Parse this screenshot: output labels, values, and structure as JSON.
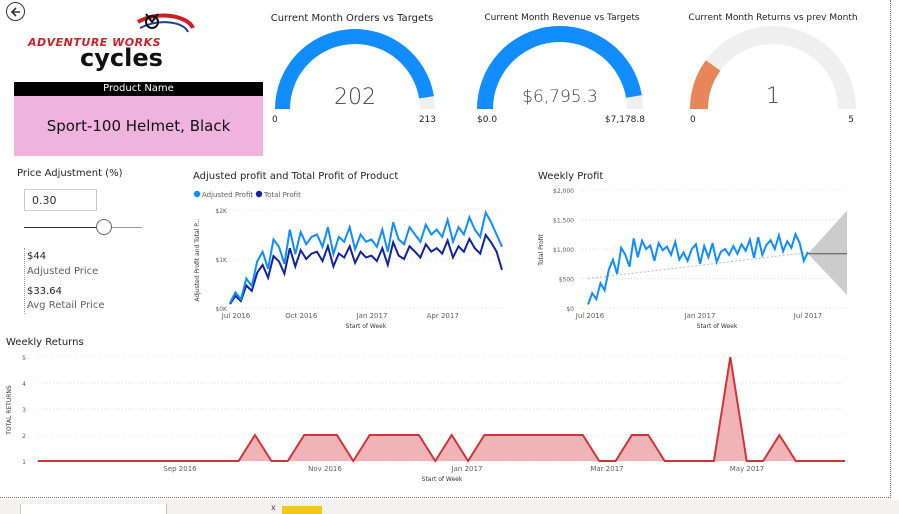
{
  "header": {
    "back_icon": "back-arrow-icon",
    "logo": {
      "line1": "ADVENTURE WORKS",
      "line2": "cycles",
      "colors": {
        "red": "#cc1f26",
        "dark": "#111111",
        "accent_blue": "#1b3fa8"
      }
    }
  },
  "slicer": {
    "header": "Product Name",
    "selected": "Sport-100 Helmet, Black"
  },
  "price_adjustment": {
    "title": "Price Adjustment (%)",
    "value": "0.30",
    "slider_fraction": 0.68,
    "adjusted_price": "$44",
    "adjusted_price_label": "Adjusted Price",
    "avg_retail_price": "$33.64",
    "avg_retail_price_label": "Avg Retail Price"
  },
  "gauges": [
    {
      "title": "Current Month Orders vs Targets",
      "value": 202,
      "display": "202",
      "min": 0,
      "max": 213,
      "min_label": "0",
      "max_label": "213",
      "color": "#118dff"
    },
    {
      "title": "Current Month Revenue vs Targets",
      "value": 6795.3,
      "display": "$6,795.3",
      "min": 0,
      "max": 7178.8,
      "min_label": "$0.0",
      "max_label": "$7,178.8",
      "color": "#118dff"
    },
    {
      "title": "Current Month Returns vs prev Month",
      "value": 1,
      "display": "1",
      "min": 0,
      "max": 5,
      "min_label": "0",
      "max_label": "5",
      "color": "#e8865a"
    }
  ],
  "chart_data": [
    {
      "type": "line",
      "title": "Adjusted profit and Total Profit of Product",
      "xlabel": "Start of Week",
      "ylabel": "Adjusted Profit and Total P...",
      "legend": "top-left",
      "x_ticks": [
        "Jul 2016",
        "Oct 2016",
        "Jan 2017",
        "Apr 2017"
      ],
      "x_tick_index": [
        0,
        12,
        25,
        38
      ],
      "y_ticks": [
        "$0K",
        "$1K",
        "$2K"
      ],
      "ylim": [
        0,
        2000
      ],
      "series": [
        {
          "name": "Adjusted Profit",
          "color": "#118dff",
          "values": [
            100,
            320,
            180,
            600,
            450,
            950,
            1150,
            800,
            1400,
            1250,
            900,
            1600,
            1100,
            1550,
            1300,
            1450,
            1500,
            1250,
            1650,
            1100,
            1450,
            1350,
            1650,
            1200,
            1500,
            1350,
            1400,
            1250,
            1600,
            1150,
            1750,
            1400,
            1300,
            1650,
            1500,
            1350,
            1700,
            1500,
            1600,
            1450,
            1800,
            1350,
            1650,
            1500,
            1850,
            1600,
            1450,
            1950,
            1750,
            1500,
            1250
          ]
        },
        {
          "name": "Total Profit",
          "color": "#12239e",
          "values": [
            80,
            250,
            140,
            460,
            350,
            720,
            880,
            620,
            1060,
            950,
            700,
            1220,
            850,
            1180,
            1000,
            1110,
            1150,
            960,
            1260,
            850,
            1110,
            1030,
            1260,
            920,
            1150,
            1030,
            1070,
            960,
            1220,
            880,
            1340,
            1070,
            1000,
            1260,
            1150,
            1030,
            1300,
            1150,
            1220,
            1110,
            1380,
            1030,
            1260,
            1150,
            1410,
            1220,
            1110,
            1490,
            1340,
            1150,
            780
          ]
        }
      ]
    },
    {
      "type": "line",
      "title": "Weekly Profit",
      "xlabel": "Start of Week",
      "ylabel": "Total Profit",
      "x_ticks": [
        "Jul 2016",
        "Jan 2017",
        "Jul 2017"
      ],
      "x_tick_index": [
        0,
        26,
        52
      ],
      "y_ticks": [
        "$0",
        "$500",
        "$1,000",
        "$1,500",
        "$2,000"
      ],
      "ylim": [
        0,
        2000
      ],
      "series": [
        {
          "name": "",
          "color": "#118dff",
          "values": [
            60,
            250,
            150,
            420,
            300,
            650,
            820,
            580,
            1020,
            900,
            700,
            1180,
            860,
            1140,
            1000,
            1060,
            800,
            1100,
            980,
            1040,
            900,
            1120,
            820,
            940,
            800,
            1000,
            1080,
            750,
            1050,
            860,
            1100,
            780,
            950,
            1000,
            900,
            1050,
            920,
            1080,
            970,
            1160,
            850,
            1200,
            900,
            1070,
            1150,
            1000,
            1230,
            960,
            1130,
            1020,
            1250,
            1100,
            800,
            950
          ]
        },
        {
          "name": "",
          "color": "#bbbbbb",
          "values": [
            500,
            940
          ]
        }
      ],
      "forecast": {
        "color": "#cccccc",
        "line_value": 920,
        "band_low": 220,
        "band_high": 1650
      }
    },
    {
      "type": "area",
      "title": "Weekly Returns",
      "xlabel": "Start of Week",
      "ylabel": "TOTAL RETURNS",
      "x_ticks": [
        "Sep 2016",
        "Nov 2016",
        "Jan 2017",
        "Mar 2017",
        "May 2017"
      ],
      "x_tick_index": [
        9,
        18,
        27,
        36,
        45
      ],
      "y_ticks": [
        "1",
        "2",
        "3",
        "4",
        "5"
      ],
      "ylim": [
        1,
        5
      ],
      "color": "#d13438",
      "fill": "#f0b4b8",
      "values": [
        1,
        1,
        1,
        1,
        1,
        1,
        1,
        1,
        1,
        1,
        1,
        1,
        1,
        1,
        2,
        1,
        1,
        2,
        2,
        2,
        1,
        2,
        2,
        2,
        2,
        1,
        2,
        1,
        2,
        2,
        2,
        2,
        2,
        2,
        2,
        1,
        1,
        2,
        2,
        1,
        1,
        1,
        1,
        5,
        1,
        1,
        2,
        1,
        1,
        1,
        1
      ]
    }
  ]
}
